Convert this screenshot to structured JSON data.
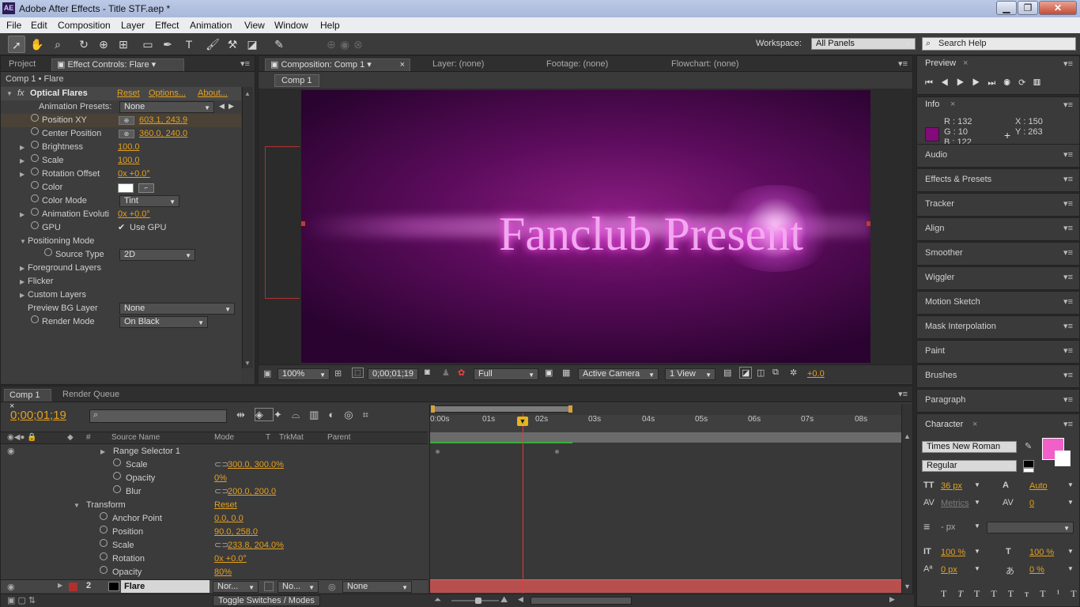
{
  "window": {
    "title": "Adobe After Effects - Title STF.aep *",
    "app_icon": "AE"
  },
  "menu": [
    "File",
    "Edit",
    "Composition",
    "Layer",
    "Effect",
    "Animation",
    "View",
    "Window",
    "Help"
  ],
  "toolbar": {
    "workspace_label": "Workspace:",
    "workspace_value": "All Panels",
    "search_placeholder": "Search Help"
  },
  "left_panel": {
    "tab_project": "Project",
    "tab_effect_controls": "Effect Controls: Flare",
    "breadcrumb": "Comp 1 • Flare",
    "effect": {
      "fx": "fx",
      "name": "Optical Flares",
      "reset": "Reset",
      "options": "Options...",
      "about": "About..."
    },
    "anim_presets_label": "Animation Presets:",
    "anim_presets_value": "None",
    "params": [
      {
        "label": "Position XY",
        "value": "603.1, 243.9"
      },
      {
        "label": "Center Position",
        "value": "360.0, 240.0"
      },
      {
        "label": "Brightness",
        "value": "100.0"
      },
      {
        "label": "Scale",
        "value": "100.0"
      },
      {
        "label": "Rotation Offset",
        "value": "0x +0.0°"
      },
      {
        "label": "Color",
        "value": ""
      },
      {
        "label": "Color Mode",
        "value": "Tint"
      },
      {
        "label": "Animation Evoluti",
        "value": "0x +0.0°"
      },
      {
        "label": "GPU",
        "value": "Use GPU"
      },
      {
        "label": "Positioning Mode",
        "value": ""
      },
      {
        "label": "Source Type",
        "value": "2D"
      },
      {
        "label": "Foreground Layers",
        "value": ""
      },
      {
        "label": "Flicker",
        "value": ""
      },
      {
        "label": "Custom Layers",
        "value": ""
      },
      {
        "label": "Preview BG Layer",
        "value": "None"
      },
      {
        "label": "Render Mode",
        "value": "On Black"
      }
    ]
  },
  "comp_panel": {
    "tab_comp": "Composition: Comp 1",
    "tab_layer": "Layer: (none)",
    "tab_footage": "Footage: (none)",
    "tab_flowchart": "Flowchart: (none)",
    "comp_button": "Comp 1",
    "viewer_text": "Fanclub Present",
    "zoom": "100%",
    "timecode": "0;00;01;19",
    "resolution": "Full",
    "camera": "Active Camera",
    "views": "1 View",
    "exposure": "+0.0"
  },
  "right_panels": {
    "preview": "Preview",
    "info": {
      "title": "Info",
      "r": "R : 132",
      "g": "G : 10",
      "b": "B : 122",
      "x": "X : 150",
      "y": "Y : 263",
      "swatch": "#84097a"
    },
    "collapsed": [
      "Audio",
      "Effects & Presets",
      "Tracker",
      "Align",
      "Smoother",
      "Wiggler",
      "Motion Sketch",
      "Mask Interpolation",
      "Paint",
      "Brushes",
      "Paragraph"
    ],
    "character": {
      "title": "Character",
      "font": "Times New Roman",
      "style": "Regular",
      "size": "36 px",
      "leading": "Auto",
      "kerning": "Metrics",
      "tracking": "0",
      "stroke_px": "- px",
      "vscale": "100 %",
      "hscale": "100 %",
      "baseline": "0 px",
      "tsume": "0 %",
      "fill_color": "#f060c8"
    }
  },
  "timeline": {
    "tab_comp": "Comp 1",
    "tab_render": "Render Queue",
    "timecode": "0;00;01;19",
    "headers": {
      "hash": "#",
      "source": "Source Name",
      "mode": "Mode",
      "t": "T",
      "trkmat": "TrkMat",
      "parent": "Parent"
    },
    "ruler": [
      "0:00s",
      "01s",
      "02s",
      "03s",
      "04s",
      "05s",
      "06s",
      "07s",
      "08s"
    ],
    "rows": [
      {
        "label": "Range Selector 1",
        "value": ""
      },
      {
        "label": "Scale",
        "value": "300.0, 300.0%"
      },
      {
        "label": "Opacity",
        "value": "0%"
      },
      {
        "label": "Blur",
        "value": "200.0, 200.0"
      },
      {
        "label": "Transform",
        "value": "Reset"
      },
      {
        "label": "Anchor Point",
        "value": "0.0, 0.0"
      },
      {
        "label": "Position",
        "value": "90.0, 258.0"
      },
      {
        "label": "Scale",
        "value": "233.8, 204.0%"
      },
      {
        "label": "Rotation",
        "value": "0x +0.0°"
      },
      {
        "label": "Opacity",
        "value": "80%"
      }
    ],
    "layer": {
      "num": "2",
      "name": "Flare",
      "mode": "Nor...",
      "trkmat": "No...",
      "parent": "None"
    },
    "toggle_label": "Toggle Switches / Modes"
  }
}
